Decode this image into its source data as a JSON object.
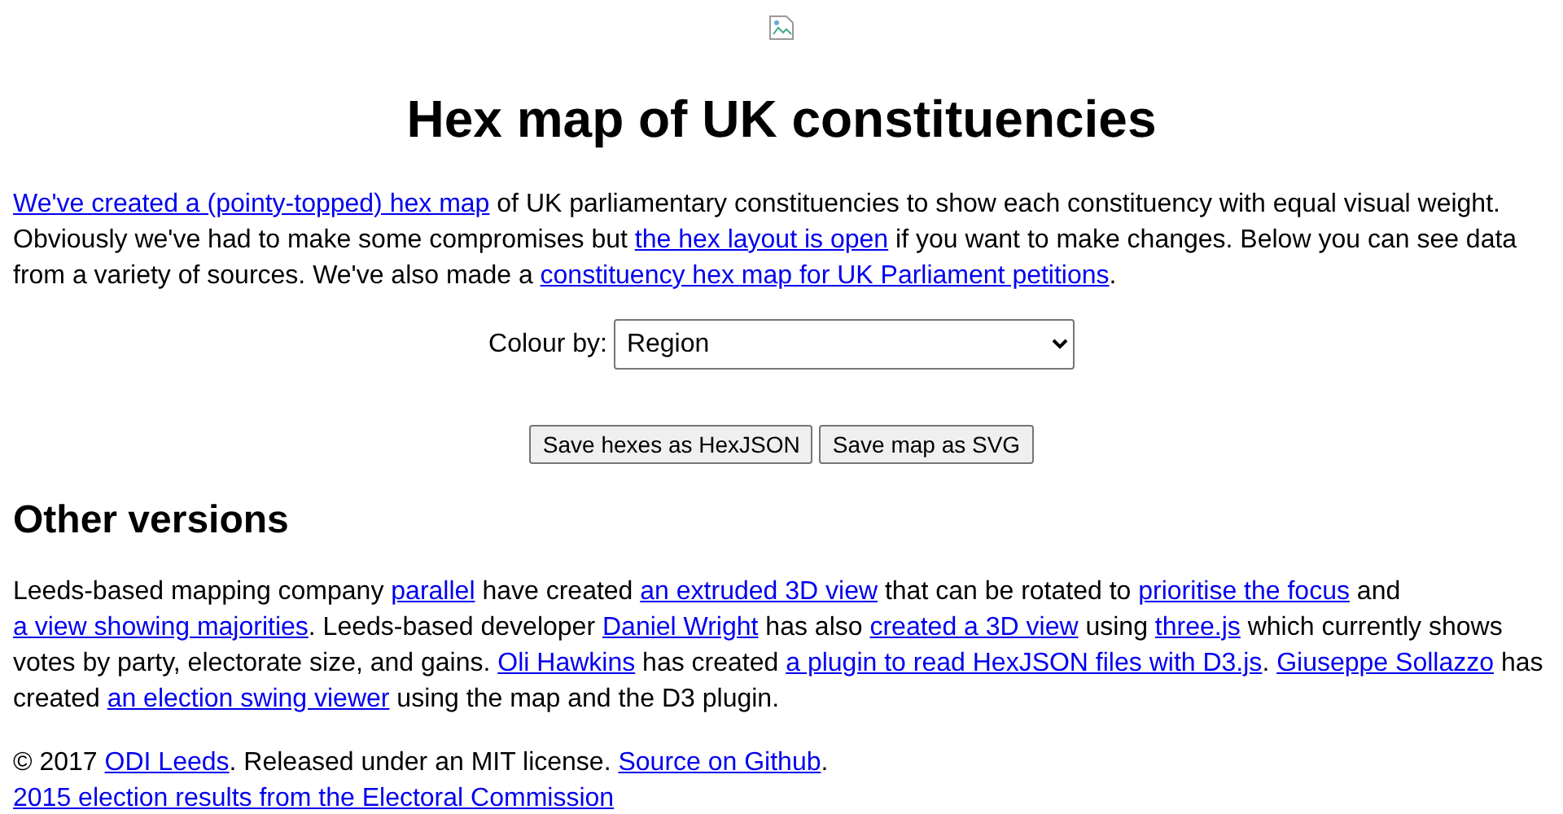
{
  "title": "Hex map of UK constituencies",
  "intro": [
    {
      "text": "We've created a (pointy-topped) hex map",
      "link": true
    },
    {
      "text": " of UK parliamentary constituencies to show each constituency with equal visual weight. Obviously we've had to make some compromises but ",
      "link": false
    },
    {
      "text": "the hex layout is open",
      "link": true
    },
    {
      "text": " if you want to make changes. Below you can see data from a variety of sources. We've also made a ",
      "link": false
    },
    {
      "text": "constituency hex map for UK Parliament petitions",
      "link": true
    },
    {
      "text": ".",
      "link": false
    }
  ],
  "colour_by": {
    "label": "Colour by:",
    "value": "Region"
  },
  "buttons": [
    "Save hexes as HexJSON",
    "Save map as SVG"
  ],
  "other_heading": "Other versions",
  "other": [
    {
      "text": "Leeds-based mapping company ",
      "link": false
    },
    {
      "text": "parallel",
      "link": true
    },
    {
      "text": " have created ",
      "link": false
    },
    {
      "text": "an extruded 3D view",
      "link": true
    },
    {
      "text": " that can be rotated to ",
      "link": false
    },
    {
      "text": "prioritise the focus",
      "link": true
    },
    {
      "text": " and ",
      "link": false
    },
    {
      "text": "a view showing majorities",
      "link": true
    },
    {
      "text": ". Leeds-based developer ",
      "link": false
    },
    {
      "text": "Daniel Wright",
      "link": true
    },
    {
      "text": " has also ",
      "link": false
    },
    {
      "text": "created a 3D view",
      "link": true
    },
    {
      "text": " using ",
      "link": false
    },
    {
      "text": "three.js",
      "link": true
    },
    {
      "text": " which currently shows votes by party, electorate size, and gains. ",
      "link": false
    },
    {
      "text": "Oli Hawkins",
      "link": true
    },
    {
      "text": " has created ",
      "link": false
    },
    {
      "text": "a plugin to read HexJSON files with D3.js",
      "link": true
    },
    {
      "text": ". ",
      "link": false
    },
    {
      "text": "Giuseppe Sollazzo",
      "link": true
    },
    {
      "text": " has created ",
      "link": false
    },
    {
      "text": "an election swing viewer",
      "link": true
    },
    {
      "text": " using the map and the D3 plugin.",
      "link": false
    }
  ],
  "footer": [
    {
      "text": "© 2017 ",
      "link": false
    },
    {
      "text": "ODI Leeds",
      "link": true
    },
    {
      "text": ". Released under an MIT license. ",
      "link": false
    },
    {
      "text": "Source on Github",
      "link": true
    },
    {
      "text": ".",
      "link": false
    }
  ],
  "sources": [
    {
      "text": "2015 election results from the Electoral Commission",
      "link": true
    }
  ]
}
